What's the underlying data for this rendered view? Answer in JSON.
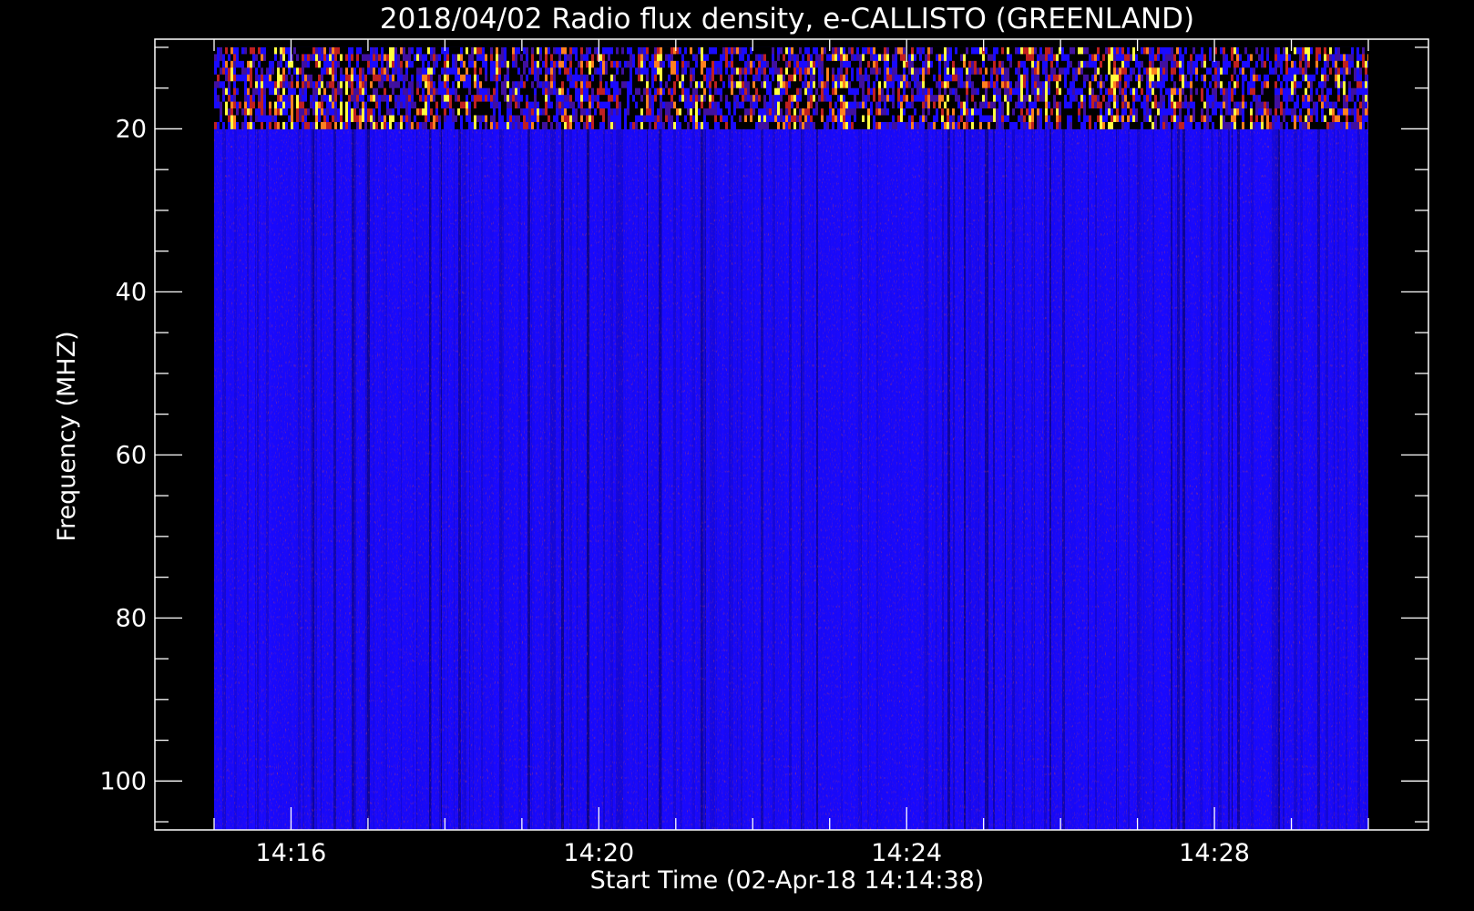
{
  "chart_data": {
    "type": "heatmap",
    "title": "2018/04/02  Radio flux density, e-CALLISTO (GREENLAND)",
    "xlabel": "Start Time (02-Apr-18 14:14:38)",
    "ylabel": "Frequency (MHZ)",
    "x_ticks": [
      "14:16",
      "14:20",
      "14:24",
      "14:28"
    ],
    "y_ticks": [
      20,
      40,
      60,
      80,
      100
    ],
    "ylim": [
      106,
      9
    ],
    "x_data_range": [
      "14:15:00",
      "14:30:00"
    ],
    "y_data_range": [
      10,
      106
    ],
    "grid": false,
    "colormap": "blue-red-yellow",
    "colors": {
      "background": "#000000",
      "low": "#1a0aff",
      "mid": "#c02020",
      "high": "#ffff40",
      "axes": "#ffffff"
    },
    "features": {
      "interference_band_mhz": [
        10,
        20
      ]
    }
  }
}
